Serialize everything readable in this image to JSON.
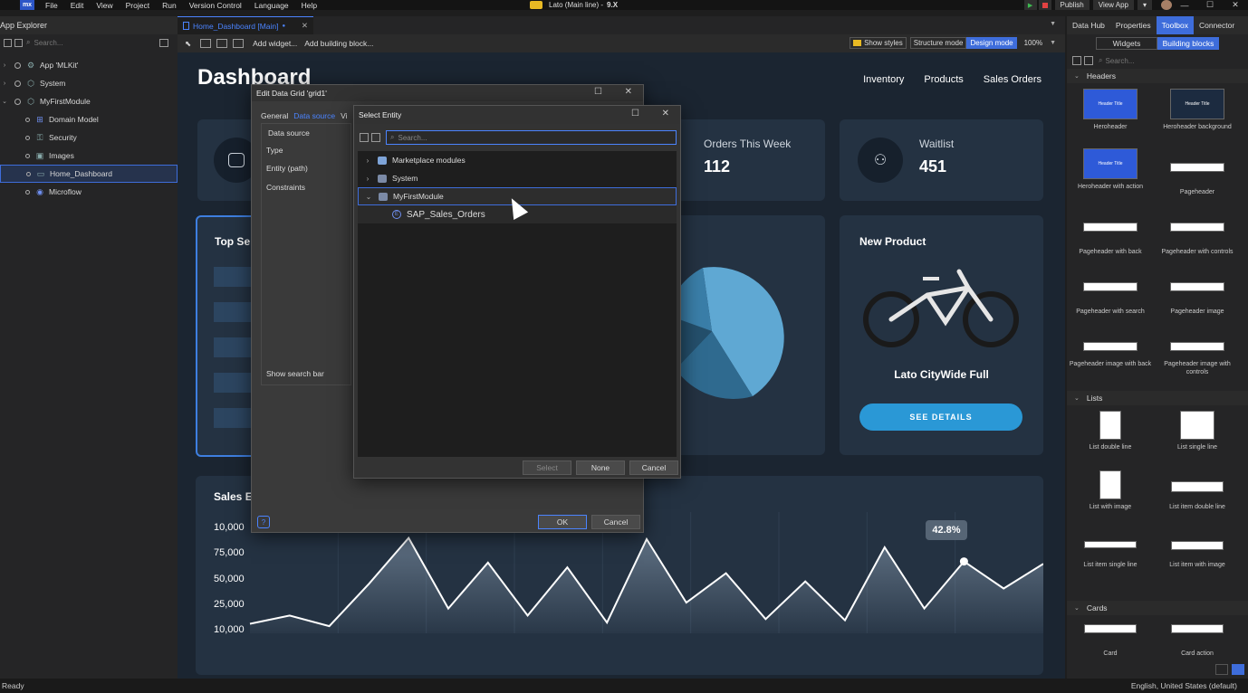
{
  "menubar": {
    "logo": "mx",
    "items": [
      "File",
      "Edit",
      "View",
      "Project",
      "Run",
      "Version Control",
      "Language",
      "Help"
    ]
  },
  "title": {
    "app": "Lato (Main line) -",
    "version": "9.X"
  },
  "topright": {
    "publish": "Publish",
    "view_app": "View App",
    "dropdown": "▾"
  },
  "window_controls": [
    "—",
    "☐",
    "✕"
  ],
  "app_explorer": {
    "title": "App Explorer",
    "search_placeholder": "Search...",
    "items": [
      {
        "label": "App 'MLKit'",
        "level": 0,
        "icon": "app-icon"
      },
      {
        "label": "System",
        "level": 0,
        "icon": "module-icon"
      },
      {
        "label": "MyFirstModule",
        "level": 0,
        "icon": "module-icon",
        "expanded": true
      },
      {
        "label": "Domain Model",
        "level": 1,
        "icon": "domain-model-icon"
      },
      {
        "label": "Security",
        "level": 1,
        "icon": "security-icon"
      },
      {
        "label": "Images",
        "level": 1,
        "icon": "images-icon"
      },
      {
        "label": "Home_Dashboard",
        "level": 1,
        "icon": "page-icon",
        "selected": true
      },
      {
        "label": "Microflow",
        "level": 1,
        "icon": "microflow-icon"
      }
    ]
  },
  "editor": {
    "tab": {
      "label": "Home_Dashboard [Main]",
      "modified": "●",
      "close": "✕"
    },
    "toolbar": {
      "add_widget": "Add widget...",
      "add_building_block": "Add building block...",
      "show_styles": "Show styles",
      "structure_mode": "Structure mode",
      "design_mode": "Design mode",
      "zoom": "100%"
    }
  },
  "dashboard": {
    "title": "Dashboard",
    "nav": [
      "Inventory",
      "Products",
      "Sales Orders"
    ],
    "stats": [
      {
        "title": "Orders This Week",
        "value": "112"
      },
      {
        "title": "Waitlist",
        "value": "451"
      }
    ],
    "top_card_title": "Top Se",
    "new_product": {
      "title": "New Product",
      "name": "Lato CityWide Full",
      "button": "SEE DETAILS"
    },
    "sales_title": "Sales E",
    "chart_tooltip": "42.8%"
  },
  "chart_data": {
    "type": "area",
    "y_ticks": [
      "10,000",
      "75,000",
      "50,000",
      "25,000",
      "10,000"
    ],
    "values": [
      5,
      12,
      3,
      39,
      78,
      18,
      57,
      12,
      53,
      6,
      77,
      23,
      48,
      9,
      41,
      8,
      70,
      18,
      58,
      35,
      56
    ]
  },
  "edit_grid_dialog": {
    "title": "Edit Data Grid 'grid1'",
    "tabs": [
      "General",
      "Data source",
      "Vi"
    ],
    "fields": [
      "Data source",
      "Type",
      "Entity (path)",
      "Constraints",
      "Show search bar"
    ],
    "ok": "OK",
    "cancel": "Cancel"
  },
  "select_entity_dialog": {
    "title": "Select Entity",
    "search_placeholder": "Search...",
    "rows": [
      {
        "label": "Marketplace modules",
        "chev": "›"
      },
      {
        "label": "System",
        "chev": "›"
      },
      {
        "label": "MyFirstModule",
        "chev": "⌄"
      }
    ],
    "entity": "SAP_Sales_Orders",
    "select": "Select",
    "none": "None",
    "cancel": "Cancel"
  },
  "right_panel": {
    "tabs": [
      "Data Hub",
      "Properties",
      "Toolbox",
      "Connector"
    ],
    "segments": [
      "Widgets",
      "Building blocks"
    ],
    "search_placeholder": "Search...",
    "sections": {
      "headers": "Headers",
      "lists": "Lists",
      "cards": "Cards"
    },
    "header_blocks": [
      "Heroheader",
      "Heroheader background",
      "Heroheader with action",
      "Pageheader",
      "Pageheader with back",
      "Pageheader with controls",
      "Pageheader with search",
      "Pageheader image",
      "Pageheader image with back",
      "Pageheader image with controls"
    ],
    "list_blocks": [
      "List double line",
      "List single line",
      "List with image",
      "List item double line",
      "List item single line",
      "List item with image"
    ],
    "card_blocks": [
      "Card",
      "Card action"
    ],
    "thumb_text": "Header Title"
  },
  "statusbar": {
    "left": "Ready",
    "right": "English, United States (default)"
  }
}
